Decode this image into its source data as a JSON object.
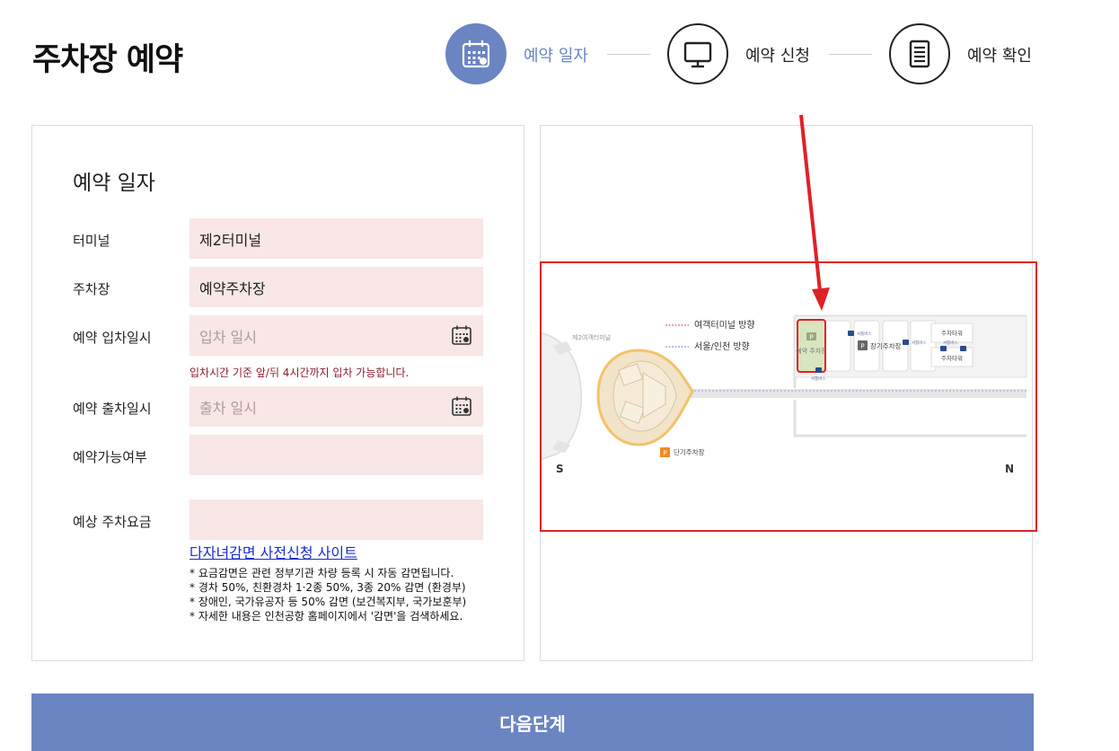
{
  "page": {
    "title": "주차장 예약"
  },
  "steps": [
    {
      "label": "예약 일자",
      "icon": "calendar-icon",
      "active": true
    },
    {
      "label": "예약 신청",
      "icon": "monitor-icon",
      "active": false
    },
    {
      "label": "예약 확인",
      "icon": "document-icon",
      "active": false
    }
  ],
  "form": {
    "title": "예약 일자",
    "terminal": {
      "label": "터미널",
      "value": "제2터미널"
    },
    "parking": {
      "label": "주차장",
      "value": "예약주차장"
    },
    "entry": {
      "label": "예약 입차일시",
      "placeholder": "입차 일시"
    },
    "entry_hint": "입차시간 기준 앞/뒤 4시간까지 입차 가능합니다.",
    "exit": {
      "label": "예약 출차일시",
      "placeholder": "출차 일시"
    },
    "availability": {
      "label": "예약가능여부",
      "value": ""
    },
    "fee": {
      "label": "예상 주차요금",
      "value": ""
    },
    "discount_link": "다자녀감면 사전신청 사이트",
    "notes": [
      "* 요금감면은 관련 정부기관 차량 등록 시 자동 감면됩니다.",
      "* 경차 50%, 친환경차 1·2종 50%, 3종 20% 감면 (환경부)",
      "* 장애인, 국가유공자 등 50% 감면 (보건복지부, 국가보훈부)",
      "* 자세한 내용은 인천공항 홈페이지에서 '감면'을 검색하세요."
    ]
  },
  "map": {
    "legend_terminal": "여객터미널 방향",
    "legend_seoul": "서울/인천 방향",
    "terminal_label": "제2여객터미널",
    "reserved_lot": "예약 주차장",
    "long_term_lot": "장기주차장",
    "parking_tower_1": "주차타워",
    "parking_tower_2": "주차타워",
    "short_term_lot": "단기주차장",
    "shuttle": "셔틀버스",
    "south": "S",
    "north": "N",
    "parking_mark": "P"
  },
  "next_button": "다음단계",
  "colors": {
    "accent": "#6b84c2",
    "field_bg": "#f9e6e6",
    "hint": "#8b1c2c",
    "highlight": "#e02027"
  }
}
